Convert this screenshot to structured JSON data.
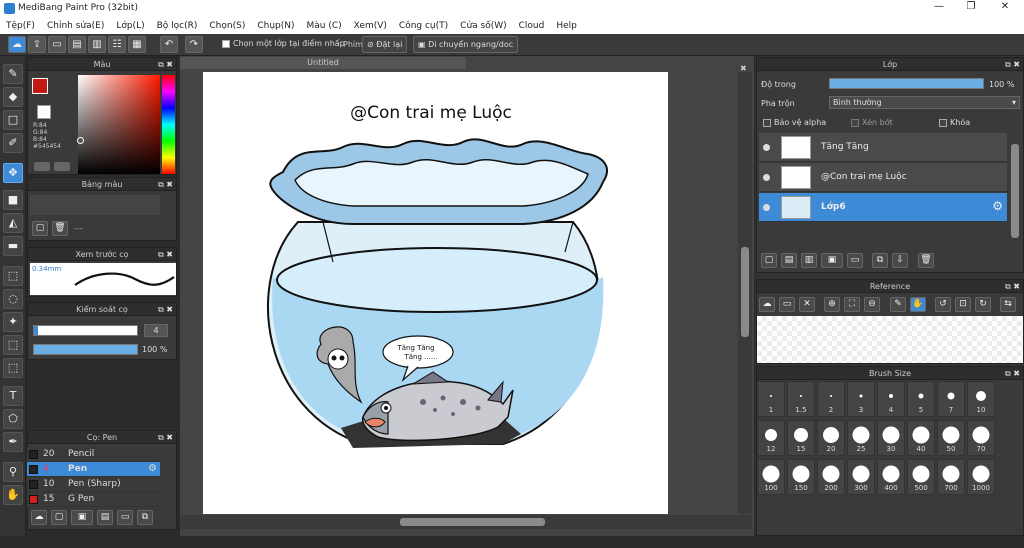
{
  "window": {
    "title": "MediBang Paint Pro (32bit)"
  },
  "menu": [
    "Tệp(F)",
    "Chỉnh sửa(E)",
    "Lớp(L)",
    "Bộ lọc(R)",
    "Chọn(S)",
    "Chụp(N)",
    "Màu (C)",
    "Xem(V)",
    "Công cụ(T)",
    "Cửa số(W)",
    "Cloud",
    "Help"
  ],
  "toolbar": {
    "select_layer_label": "Chọn một lớp tại điểm nhấp",
    "phim_label": "Phím",
    "reset_label": "Đặt lại",
    "flip_label": "Di chuyển ngang/doc"
  },
  "color_panel": {
    "title": "Màu",
    "r": "R:84",
    "g": "G:84",
    "b": "B:84",
    "hex": "#545454",
    "primary_color": "#c21a12"
  },
  "palette_panel": {
    "title": "Bảng màu",
    "dash": "---"
  },
  "brush_preview_panel": {
    "title": "Xem trước cọ",
    "size": "0.34mm"
  },
  "brush_control_panel": {
    "title": "Kiểm soát cọ",
    "size_value": "4",
    "opacity_value": "100 %",
    "size_fraction": 0.04,
    "opacity_fraction": 1.0
  },
  "brush_list_panel": {
    "title": "Cọ: Pen",
    "brushes": [
      {
        "size": "20",
        "name": "Pencil",
        "color": "#222222",
        "selected": false
      },
      {
        "size": "4",
        "name": "Pen",
        "color": "#222222",
        "selected": true
      },
      {
        "size": "10",
        "name": "Pen (Sharp)",
        "color": "#222222",
        "selected": false
      },
      {
        "size": "15",
        "name": "G Pen",
        "color": "#d42020",
        "selected": false
      }
    ]
  },
  "document": {
    "tab_title": "Untitled"
  },
  "artwork": {
    "caption": "@Con trai mẹ Luộc",
    "speech_line1": "Tăng Tăng",
    "speech_line2": "Tăng ......"
  },
  "layer_panel": {
    "title": "Lớp",
    "opacity_label": "Độ trong",
    "opacity_value": "100 %",
    "opacity_fraction": 1.0,
    "blend_label": "Pha trộn",
    "blend_value": "Bình thường",
    "protect_alpha": "Bảo vệ alpha",
    "clipping": "Xén bớt",
    "lock": "Khóa",
    "layers": [
      {
        "name": "Tăng Tăng",
        "selected": false
      },
      {
        "name": "@Con trai mẹ Luộc",
        "selected": false
      },
      {
        "name": "Lớp6",
        "selected": true
      }
    ]
  },
  "reference_panel": {
    "title": "Reference"
  },
  "brush_size_panel": {
    "title": "Brush Size",
    "sizes": [
      "1",
      "1.5",
      "2",
      "3",
      "4",
      "5",
      "7",
      "10",
      "12",
      "15",
      "20",
      "25",
      "30",
      "40",
      "50",
      "70",
      "100",
      "150",
      "200",
      "300",
      "400",
      "500",
      "700",
      "1000"
    ]
  }
}
